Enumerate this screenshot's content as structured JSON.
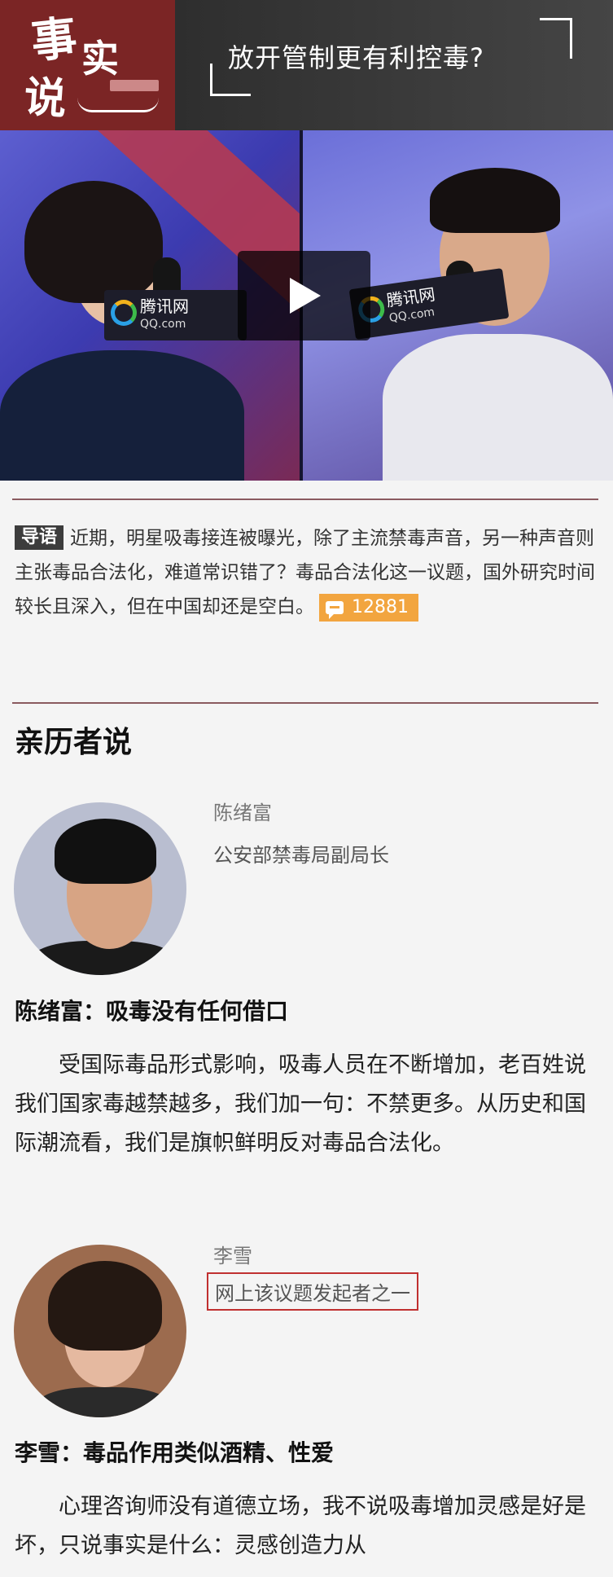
{
  "banner": {
    "logo_shi": "事",
    "logo_shishi": "实",
    "logo_shuo": "说",
    "title": "放开管制更有利控毒?"
  },
  "video": {
    "mic_brand": "腾讯网",
    "mic_brand_sub": "QQ.com"
  },
  "lead": {
    "tag": "导语",
    "text": "近期，明星吸毒接连被曝光，除了主流禁毒声音，另一种声音则主张毒品合法化，难道常识错了？毒品合法化这一议题，国外研究时间较长且深入，但在中国却还是空白。",
    "comment_count": "12881"
  },
  "section": {
    "heading": "亲历者说"
  },
  "people": [
    {
      "name": "陈绪富",
      "title": "公安部禁毒局副局长",
      "quote_heading": "陈绪富：吸毒没有任何借口",
      "body": "受国际毒品形式影响，吸毒人员在不断增加，老百姓说我们国家毒越禁越多，我们加一句：不禁更多。从历史和国际潮流看，我们是旗帜鲜明反对毒品合法化。"
    },
    {
      "name": "李雪",
      "title": "网上该议题发起者之一",
      "quote_heading": "李雪：毒品作用类似酒精、性爱",
      "body": "心理咨询师没有道德立场，我不说吸毒增加灵感是好是坏，只说事实是什么：灵感创造力从"
    }
  ]
}
